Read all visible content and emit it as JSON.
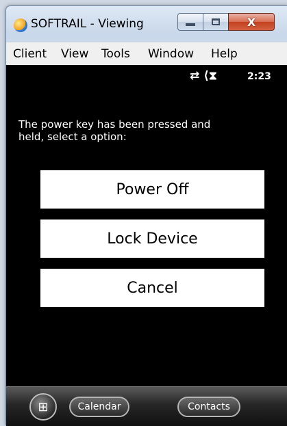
{
  "window": {
    "title": "SOFTRAIL - Viewing",
    "close_glyph": "X"
  },
  "menu": [
    "Client",
    "View",
    "Tools",
    "Window",
    "Help"
  ],
  "status": {
    "icons": "⇄ ⟨⧗",
    "time": "2:23"
  },
  "dialog": {
    "message": "The power key has been pressed and held, select a option:",
    "options": [
      "Power Off",
      "Lock Device",
      "Cancel"
    ]
  },
  "taskbar": {
    "start_glyph": "⊞",
    "left_softkey": "Calendar",
    "right_softkey": "Contacts"
  }
}
